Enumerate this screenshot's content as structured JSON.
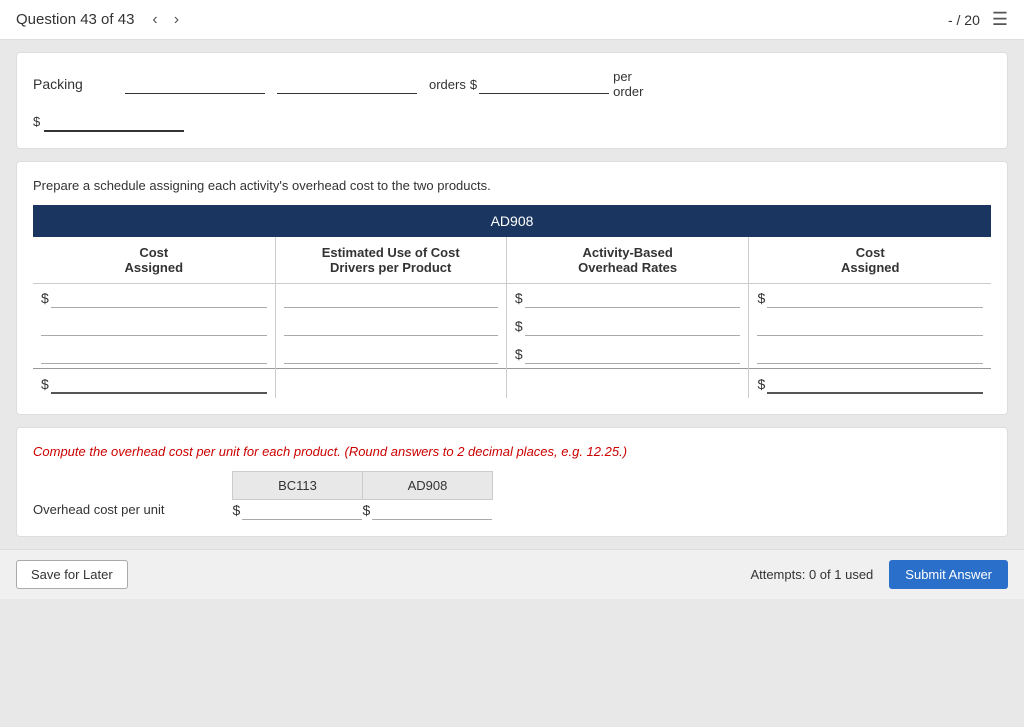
{
  "nav": {
    "title": "Question 43 of 43",
    "prev_arrow": "‹",
    "next_arrow": "›",
    "score": "- / 20",
    "list_icon": "☰"
  },
  "top_card": {
    "packing_label": "Packing",
    "orders_label": "orders",
    "per_order_label": "per\norder",
    "dollar_sign": "$"
  },
  "middle_card": {
    "instruction": "Prepare a schedule assigning each activity's overhead cost to the two products.",
    "header": "AD908",
    "col1_header": "Cost\nAssigned",
    "col2_header": "Estimated Use of Cost\nDrivers per Product",
    "col3_header": "Activity-Based\nOverhead Rates",
    "col4_header": "Cost\nAssigned",
    "rows": [
      {
        "has_dollar_col1": true,
        "has_dollar_col3": true,
        "has_dollar_col4": true
      },
      {
        "has_dollar_col1": false,
        "has_dollar_col3": true,
        "has_dollar_col4": false
      },
      {
        "has_dollar_col1": false,
        "has_dollar_col3": true,
        "has_dollar_col4": false
      },
      {
        "has_dollar_col1": true,
        "has_dollar_col3": false,
        "has_dollar_col4": true,
        "is_total": true
      }
    ]
  },
  "bottom_card": {
    "instruction": "Compute the overhead cost per unit for each product.",
    "instruction_note": "(Round answers to 2 decimal places, e.g. 12.25.)",
    "col_bc": "BC113",
    "col_ad": "AD908",
    "row_label": "Overhead cost per unit",
    "dollar_sign": "$"
  },
  "footer": {
    "save_later_label": "Save for Later",
    "attempts_text": "Attempts: 0 of 1 used",
    "submit_label": "Submit Answer"
  }
}
